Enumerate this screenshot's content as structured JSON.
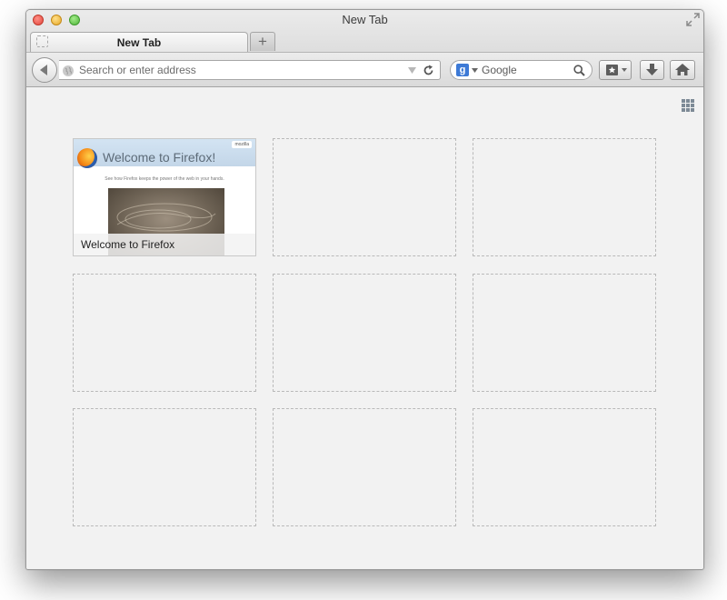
{
  "window": {
    "title": "New Tab"
  },
  "tab": {
    "label": "New Tab",
    "new_tab_symbol": "+"
  },
  "navbar": {
    "address_placeholder": "Search or enter address",
    "search_engine": "Google",
    "search_engine_badge": "g",
    "search_placeholder": "Google"
  },
  "content": {
    "tiles": [
      {
        "title": "Welcome to Firefox",
        "thumbnail": {
          "brand": "mozilla",
          "heading": "Welcome to Firefox!",
          "subtitle": "See how Firefox keeps the power of the web in your hands."
        }
      }
    ],
    "empty_tiles": 8
  },
  "icons": {
    "back": "back-arrow-icon",
    "globe": "globe-icon",
    "reload": "reload-icon",
    "search": "magnifier-icon",
    "bookmarks": "bookmarks-star-icon",
    "downloads": "download-arrow-icon",
    "home": "home-icon",
    "grid": "grid-toggle-icon",
    "fullscreen": "fullscreen-icon"
  },
  "colors": {
    "close": "#e2463d",
    "minimize": "#e7a829",
    "zoom": "#4fb53b",
    "content_background": "#f2f2f2",
    "engine_badge": "#3d7ad6"
  }
}
